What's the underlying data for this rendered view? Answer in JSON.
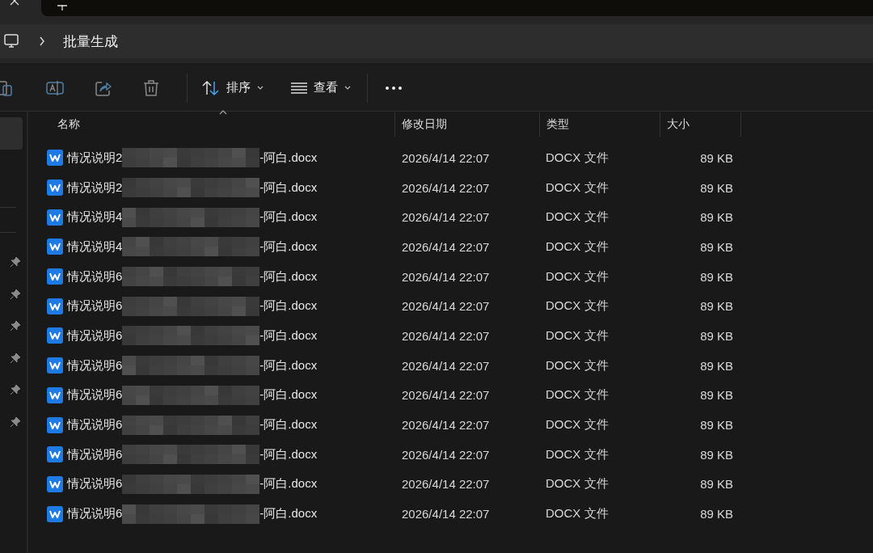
{
  "address_bar": {
    "path": [
      "批量生成"
    ]
  },
  "toolbar": {
    "sort_label": "排序",
    "view_label": "查看"
  },
  "sidebar": {
    "top_item": {
      "selected": true
    },
    "items": [
      {
        "pinned": true
      },
      {
        "pinned": true
      },
      {
        "pinned": true
      },
      {
        "pinned": true
      },
      {
        "pinned": true
      },
      {
        "pinned": true
      }
    ]
  },
  "table": {
    "columns": [
      {
        "label": "名称",
        "sorted": true
      },
      {
        "label": "修改日期",
        "sorted": false
      },
      {
        "label": "类型",
        "sorted": false
      },
      {
        "label": "大小",
        "sorted": false
      }
    ],
    "rows": [
      {
        "name_start": "情况说明2",
        "name_blurred": true,
        "name_end": "-阿白.docx",
        "modified": "2026/4/14 22:07",
        "type": "DOCX 文件",
        "size": "89 KB"
      },
      {
        "name_start": "情况说明2",
        "name_blurred": true,
        "name_end": "-阿白.docx",
        "modified": "2026/4/14 22:07",
        "type": "DOCX 文件",
        "size": "89 KB"
      },
      {
        "name_start": "情况说明4",
        "name_blurred": true,
        "name_end": "-阿白.docx",
        "modified": "2026/4/14 22:07",
        "type": "DOCX 文件",
        "size": "89 KB"
      },
      {
        "name_start": "情况说明4",
        "name_blurred": true,
        "name_end": "-阿白.docx",
        "modified": "2026/4/14 22:07",
        "type": "DOCX 文件",
        "size": "89 KB"
      },
      {
        "name_start": "情况说明6",
        "name_blurred": true,
        "name_end": "-阿白.docx",
        "modified": "2026/4/14 22:07",
        "type": "DOCX 文件",
        "size": "89 KB"
      },
      {
        "name_start": "情况说明6",
        "name_blurred": true,
        "name_end": "-阿白.docx",
        "modified": "2026/4/14 22:07",
        "type": "DOCX 文件",
        "size": "89 KB"
      },
      {
        "name_start": "情况说明6",
        "name_blurred": true,
        "name_end": "-阿白.docx",
        "modified": "2026/4/14 22:07",
        "type": "DOCX 文件",
        "size": "89 KB"
      },
      {
        "name_start": "情况说明6",
        "name_blurred": true,
        "name_end": "-阿白.docx",
        "modified": "2026/4/14 22:07",
        "type": "DOCX 文件",
        "size": "89 KB"
      },
      {
        "name_start": "情况说明6",
        "name_blurred": true,
        "name_end": "-阿白.docx",
        "modified": "2026/4/14 22:07",
        "type": "DOCX 文件",
        "size": "89 KB"
      },
      {
        "name_start": "情况说明6",
        "name_blurred": true,
        "name_end": "-阿白.docx",
        "modified": "2026/4/14 22:07",
        "type": "DOCX 文件",
        "size": "89 KB"
      },
      {
        "name_start": "情况说明6",
        "name_blurred": true,
        "name_end": "-阿白.docx",
        "modified": "2026/4/14 22:07",
        "type": "DOCX 文件",
        "size": "89 KB"
      },
      {
        "name_start": "情况说明6",
        "name_blurred": true,
        "name_end": "-阿白.docx",
        "modified": "2026/4/14 22:07",
        "type": "DOCX 文件",
        "size": "89 KB"
      },
      {
        "name_start": "情况说明6",
        "name_blurred": true,
        "name_end": "-阿白.docx",
        "modified": "2026/4/14 22:07",
        "type": "DOCX 文件",
        "size": "89 KB"
      }
    ]
  }
}
